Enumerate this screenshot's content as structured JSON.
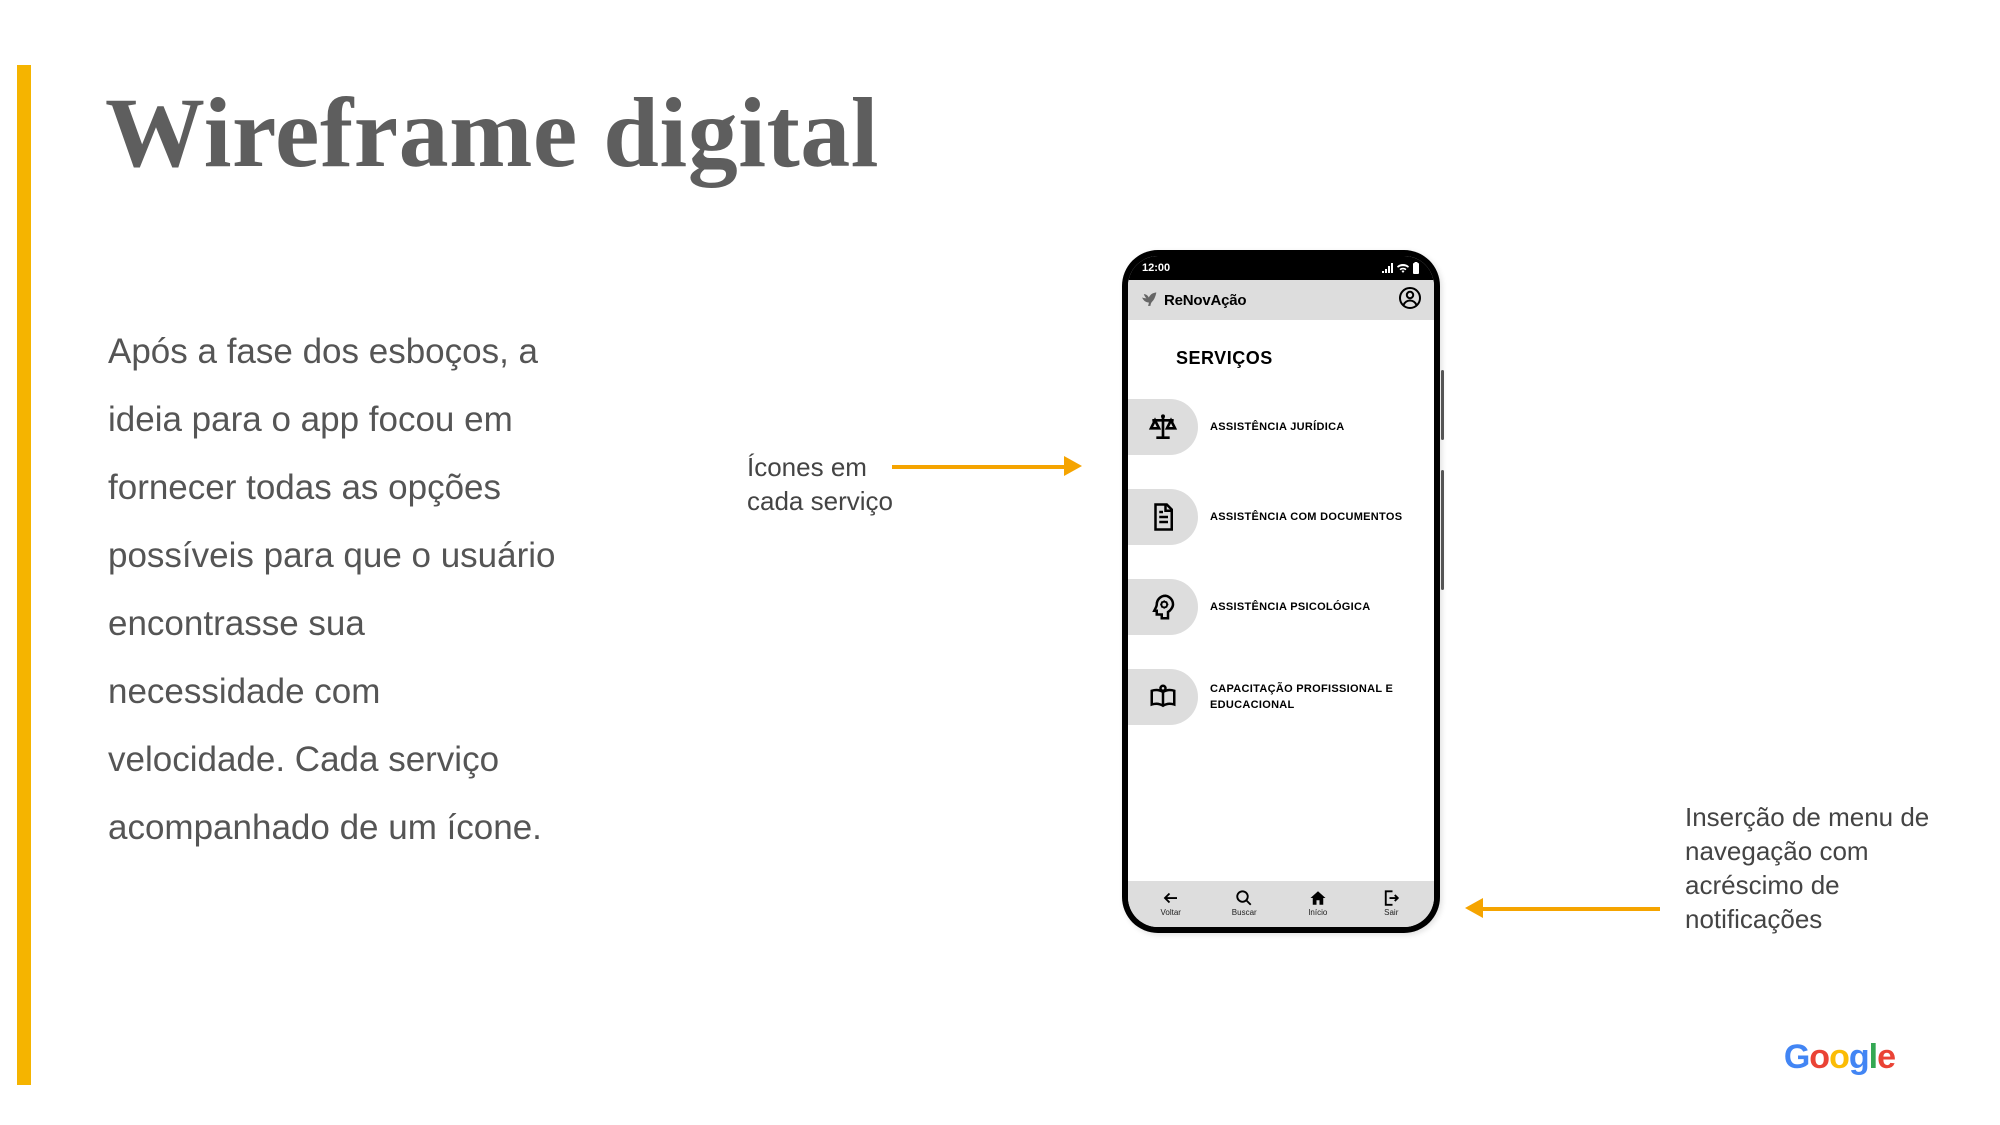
{
  "slide": {
    "title": "Wireframe digital",
    "body": "Após a fase dos esboços, a ideia para o app focou em fornecer todas as opções possíveis para que o usuário encontrasse sua necessidade com velocidade. Cada serviço acompanhado de um ícone.",
    "annotations": {
      "left": "Ícones em\ncada serviço",
      "right": "Inserção de menu de navegação com acréscimo de notificações"
    },
    "footer_logo_letters": {
      "g1": "G",
      "o1": "o",
      "o2": "o",
      "g2": "g",
      "l": "l",
      "e": "e"
    }
  },
  "phone": {
    "status": {
      "time": "12:00"
    },
    "header": {
      "brand": "ReNovAção"
    },
    "section_title": "SERVIÇOS",
    "services": [
      {
        "label": "ASSISTÊNCIA JURÍDICA"
      },
      {
        "label": "ASSISTÊNCIA COM DOCUMENTOS"
      },
      {
        "label": "ASSISTÊNCIA PSICOLÓGICA"
      },
      {
        "label": "CAPACITAÇÃO PROFISSIONAL E EDUCACIONAL"
      }
    ],
    "nav": [
      {
        "label": "Voltar"
      },
      {
        "label": "Buscar"
      },
      {
        "label": "Início"
      },
      {
        "label": "Sair"
      }
    ]
  }
}
